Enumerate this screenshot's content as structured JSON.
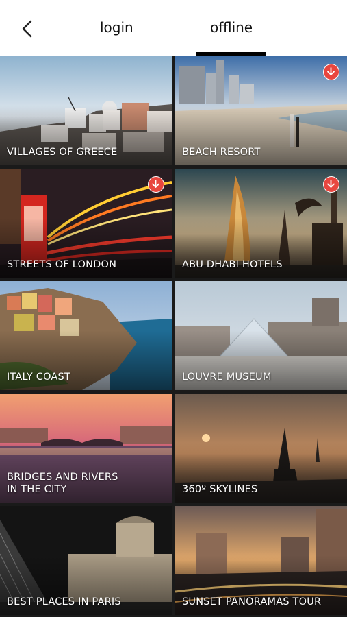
{
  "header": {
    "back_icon": "back-chevron-icon",
    "tabs": [
      {
        "label": "login",
        "active": false
      },
      {
        "label": "offline",
        "active": true
      }
    ]
  },
  "tiles": [
    {
      "title": "VILLAGES OF GREECE",
      "download": false
    },
    {
      "title": "BEACH RESORT",
      "download": true
    },
    {
      "title": "STREETS OF LONDON",
      "download": true
    },
    {
      "title": "ABU DHABI HOTELS",
      "download": true
    },
    {
      "title": "ITALY COAST",
      "download": false
    },
    {
      "title": "LOUVRE MUSEUM",
      "download": false
    },
    {
      "title": "BRIDGES AND RIVERS\nIN THE CITY",
      "download": false
    },
    {
      "title": "360º SKYLINES",
      "download": false
    },
    {
      "title": "BEST PLACES IN PARIS",
      "download": false
    },
    {
      "title": "SUNSET PANORAMAS TOUR",
      "download": false
    }
  ],
  "colors": {
    "accent_download": "#e8463f",
    "tab_underline": "#000000"
  }
}
